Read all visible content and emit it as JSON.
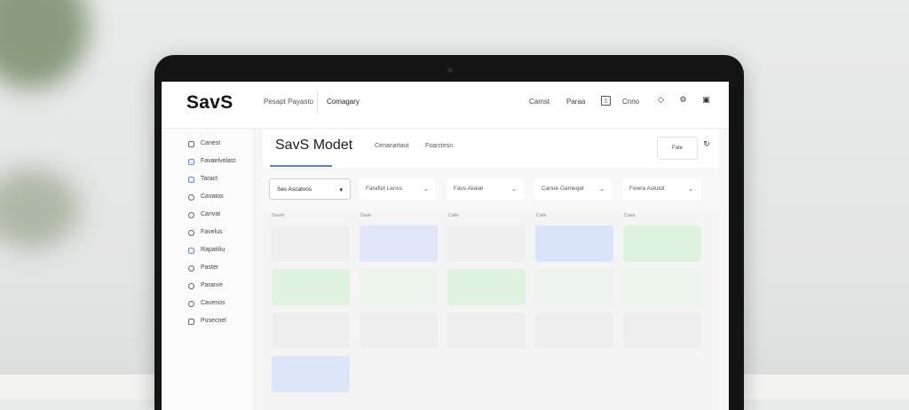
{
  "app": {
    "logo": "SavS",
    "page_title": "SavS Modet"
  },
  "topbar": {
    "nav": [
      "Pesapt Payasto",
      "Comagary",
      "Camst",
      "Paraa",
      "Cnno"
    ]
  },
  "sidebar": {
    "items": [
      {
        "label": "Canest",
        "icon": "square-icon"
      },
      {
        "label": "Favaelvelast",
        "icon": "checkbox-icon"
      },
      {
        "label": "Taract",
        "icon": "checkbox-icon"
      },
      {
        "label": "Cavatos",
        "icon": "circle-icon"
      },
      {
        "label": "Canvat",
        "icon": "circle-icon"
      },
      {
        "label": "Favelus",
        "icon": "circle-icon"
      },
      {
        "label": "Rapatiliu",
        "icon": "checkbox-icon"
      },
      {
        "label": "Paster",
        "icon": "circle-icon"
      },
      {
        "label": "Paranre",
        "icon": "circle-icon"
      },
      {
        "label": "Cavenos",
        "icon": "circle-icon"
      },
      {
        "label": "Pusecnel",
        "icon": "square-icon"
      }
    ]
  },
  "main": {
    "sub_tabs": [
      "Cenanartaut",
      "Foarctesn"
    ],
    "header_box_label": "Fate",
    "filters": [
      "Ses Ascatvos",
      "Faraflot Lenss",
      "Favs Aiiaiat",
      "Canue Gameqat",
      "Fewra Astutot"
    ],
    "column_labels": [
      "Savot",
      "Gaat",
      "Cate",
      "Cate",
      "Cass"
    ]
  },
  "colors": {
    "accent": "#5d7fd0",
    "card_blue": "#dfe6f8",
    "card_green": "#e2f3e3",
    "card_gray": "#ededed"
  }
}
